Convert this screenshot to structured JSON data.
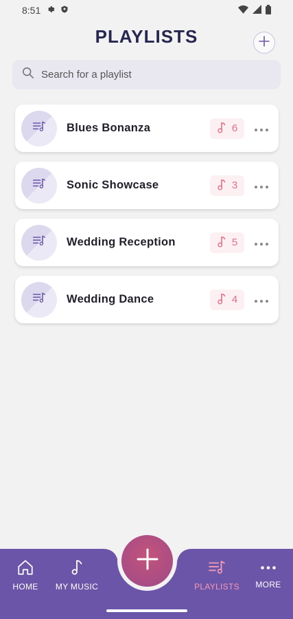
{
  "status_bar": {
    "time": "8:51",
    "icons": [
      "gear-icon",
      "shield-icon",
      "wifi-icon",
      "signal-icon",
      "battery-icon"
    ]
  },
  "header": {
    "title": "PLAYLISTS",
    "add_icon": "plus-icon"
  },
  "search": {
    "placeholder": "Search for a playlist"
  },
  "playlists": [
    {
      "name": "Blues Bonanza",
      "count": "6"
    },
    {
      "name": "Sonic Showcase",
      "count": "3"
    },
    {
      "name": "Wedding Reception",
      "count": "5"
    },
    {
      "name": "Wedding Dance",
      "count": "4"
    }
  ],
  "bottom_nav": {
    "items": [
      {
        "label": "HOME",
        "icon": "home-icon"
      },
      {
        "label": "MY MUSIC",
        "icon": "music-note-icon"
      },
      {
        "label": "PLAYLISTS",
        "icon": "playlist-icon",
        "active": true
      },
      {
        "label": "MORE",
        "icon": "more-icon"
      }
    ],
    "fab_icon": "plus-icon"
  },
  "colors": {
    "accent": "#6a55a8",
    "badge_text": "#e0708a",
    "active_nav": "#f59ab5",
    "fab": "#b14f80",
    "title": "#262650"
  }
}
